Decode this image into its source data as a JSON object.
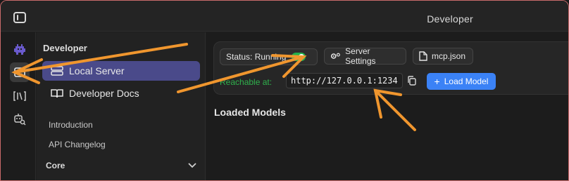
{
  "titlebar": {
    "title": "Developer"
  },
  "iconrail": {
    "items": [
      {
        "icon": "robot-icon"
      },
      {
        "icon": "terminal-icon",
        "active": true
      },
      {
        "icon": "book-bracket-icon"
      },
      {
        "icon": "robot-search-icon"
      }
    ]
  },
  "sidebar": {
    "section_title": "Developer",
    "items": [
      {
        "label": "Local Server",
        "icon": "server-icon",
        "active": true
      },
      {
        "label": "Developer Docs",
        "icon": "book-icon"
      }
    ],
    "links": [
      "Introduction",
      "API Changelog"
    ],
    "core_label": "Core"
  },
  "server": {
    "status_label": "Status: Running",
    "running": true,
    "settings_label": "Server Settings",
    "mcp_label": "mcp.json",
    "reachable_label": "Reachable at:",
    "url": "http://127.0.0.1:1234",
    "load_model_label": "Load Model"
  },
  "main": {
    "loaded_models_title": "Loaded Models"
  },
  "colors": {
    "accent": "#3b82f6",
    "toggle_on": "#22b14c",
    "reachable_text": "#2fb14c",
    "active_nav": "#4a4a8a",
    "annotation_arrow": "#f0962e"
  }
}
